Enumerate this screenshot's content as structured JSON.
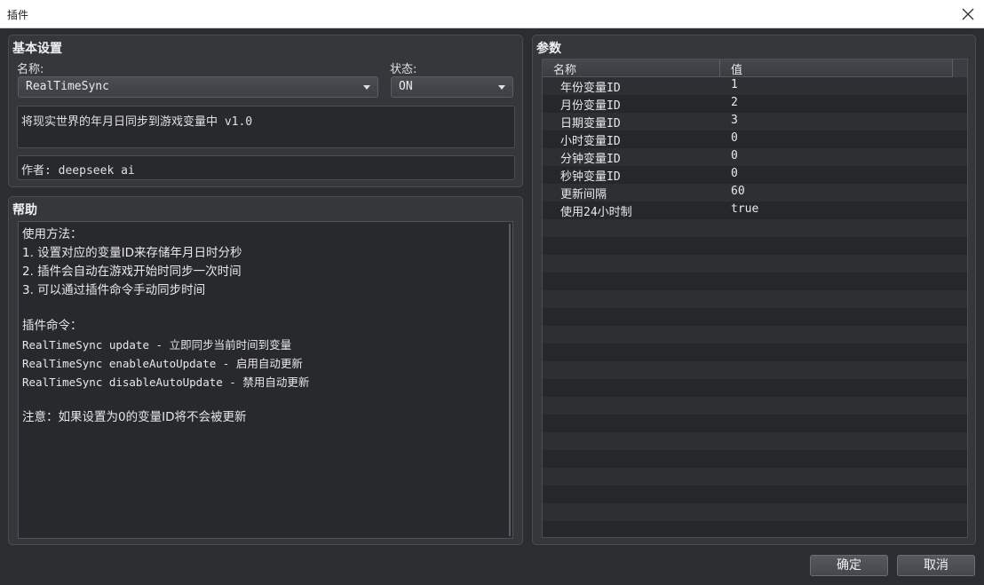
{
  "window": {
    "title": "插件"
  },
  "basic": {
    "title": "基本设置",
    "name_label": "名称:",
    "name_value": "RealTimeSync",
    "status_label": "状态:",
    "status_value": "ON",
    "description": "将现实世界的年月日同步到游戏变量中 v1.0",
    "author": "作者: deepseek ai"
  },
  "help": {
    "title": "帮助",
    "lines": [
      "使用方法：",
      "1. 设置对应的变量ID来存储年月日时分秒",
      "2. 插件会自动在游戏开始时同步一次时间",
      "3. 可以通过插件命令手动同步时间",
      "",
      "插件命令：",
      "RealTimeSync update - 立即同步当前时间到变量",
      "RealTimeSync enableAutoUpdate - 启用自动更新",
      "RealTimeSync disableAutoUpdate - 禁用自动更新",
      "",
      "注意：如果设置为0的变量ID将不会被更新"
    ]
  },
  "params": {
    "title": "参数",
    "col_name": "名称",
    "col_value": "值",
    "rows": [
      {
        "name": "年份变量ID",
        "value": "1"
      },
      {
        "name": "月份变量ID",
        "value": "2"
      },
      {
        "name": "日期变量ID",
        "value": "3"
      },
      {
        "name": "小时变量ID",
        "value": "0"
      },
      {
        "name": "分钟变量ID",
        "value": "0"
      },
      {
        "name": "秒钟变量ID",
        "value": "0"
      },
      {
        "name": "更新间隔",
        "value": "60"
      },
      {
        "name": "使用24小时制",
        "value": "true"
      }
    ]
  },
  "buttons": {
    "ok": "确定",
    "cancel": "取消"
  }
}
